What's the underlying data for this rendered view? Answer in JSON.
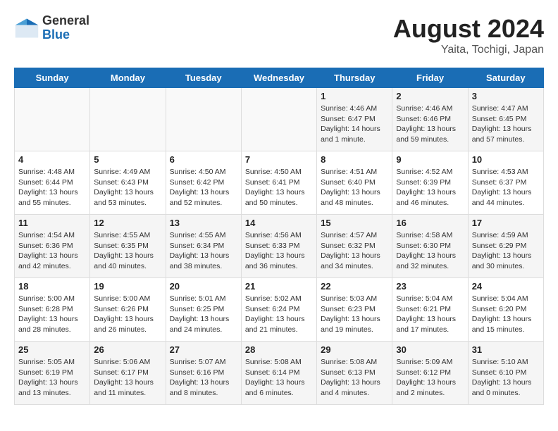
{
  "logo": {
    "general": "General",
    "blue": "Blue"
  },
  "title": "August 2024",
  "subtitle": "Yaita, Tochigi, Japan",
  "days_of_week": [
    "Sunday",
    "Monday",
    "Tuesday",
    "Wednesday",
    "Thursday",
    "Friday",
    "Saturday"
  ],
  "weeks": [
    [
      {
        "day": "",
        "info": ""
      },
      {
        "day": "",
        "info": ""
      },
      {
        "day": "",
        "info": ""
      },
      {
        "day": "",
        "info": ""
      },
      {
        "day": "1",
        "info": "Sunrise: 4:46 AM\nSunset: 6:47 PM\nDaylight: 14 hours\nand 1 minute."
      },
      {
        "day": "2",
        "info": "Sunrise: 4:46 AM\nSunset: 6:46 PM\nDaylight: 13 hours\nand 59 minutes."
      },
      {
        "day": "3",
        "info": "Sunrise: 4:47 AM\nSunset: 6:45 PM\nDaylight: 13 hours\nand 57 minutes."
      }
    ],
    [
      {
        "day": "4",
        "info": "Sunrise: 4:48 AM\nSunset: 6:44 PM\nDaylight: 13 hours\nand 55 minutes."
      },
      {
        "day": "5",
        "info": "Sunrise: 4:49 AM\nSunset: 6:43 PM\nDaylight: 13 hours\nand 53 minutes."
      },
      {
        "day": "6",
        "info": "Sunrise: 4:50 AM\nSunset: 6:42 PM\nDaylight: 13 hours\nand 52 minutes."
      },
      {
        "day": "7",
        "info": "Sunrise: 4:50 AM\nSunset: 6:41 PM\nDaylight: 13 hours\nand 50 minutes."
      },
      {
        "day": "8",
        "info": "Sunrise: 4:51 AM\nSunset: 6:40 PM\nDaylight: 13 hours\nand 48 minutes."
      },
      {
        "day": "9",
        "info": "Sunrise: 4:52 AM\nSunset: 6:39 PM\nDaylight: 13 hours\nand 46 minutes."
      },
      {
        "day": "10",
        "info": "Sunrise: 4:53 AM\nSunset: 6:37 PM\nDaylight: 13 hours\nand 44 minutes."
      }
    ],
    [
      {
        "day": "11",
        "info": "Sunrise: 4:54 AM\nSunset: 6:36 PM\nDaylight: 13 hours\nand 42 minutes."
      },
      {
        "day": "12",
        "info": "Sunrise: 4:55 AM\nSunset: 6:35 PM\nDaylight: 13 hours\nand 40 minutes."
      },
      {
        "day": "13",
        "info": "Sunrise: 4:55 AM\nSunset: 6:34 PM\nDaylight: 13 hours\nand 38 minutes."
      },
      {
        "day": "14",
        "info": "Sunrise: 4:56 AM\nSunset: 6:33 PM\nDaylight: 13 hours\nand 36 minutes."
      },
      {
        "day": "15",
        "info": "Sunrise: 4:57 AM\nSunset: 6:32 PM\nDaylight: 13 hours\nand 34 minutes."
      },
      {
        "day": "16",
        "info": "Sunrise: 4:58 AM\nSunset: 6:30 PM\nDaylight: 13 hours\nand 32 minutes."
      },
      {
        "day": "17",
        "info": "Sunrise: 4:59 AM\nSunset: 6:29 PM\nDaylight: 13 hours\nand 30 minutes."
      }
    ],
    [
      {
        "day": "18",
        "info": "Sunrise: 5:00 AM\nSunset: 6:28 PM\nDaylight: 13 hours\nand 28 minutes."
      },
      {
        "day": "19",
        "info": "Sunrise: 5:00 AM\nSunset: 6:26 PM\nDaylight: 13 hours\nand 26 minutes."
      },
      {
        "day": "20",
        "info": "Sunrise: 5:01 AM\nSunset: 6:25 PM\nDaylight: 13 hours\nand 24 minutes."
      },
      {
        "day": "21",
        "info": "Sunrise: 5:02 AM\nSunset: 6:24 PM\nDaylight: 13 hours\nand 21 minutes."
      },
      {
        "day": "22",
        "info": "Sunrise: 5:03 AM\nSunset: 6:23 PM\nDaylight: 13 hours\nand 19 minutes."
      },
      {
        "day": "23",
        "info": "Sunrise: 5:04 AM\nSunset: 6:21 PM\nDaylight: 13 hours\nand 17 minutes."
      },
      {
        "day": "24",
        "info": "Sunrise: 5:04 AM\nSunset: 6:20 PM\nDaylight: 13 hours\nand 15 minutes."
      }
    ],
    [
      {
        "day": "25",
        "info": "Sunrise: 5:05 AM\nSunset: 6:19 PM\nDaylight: 13 hours\nand 13 minutes."
      },
      {
        "day": "26",
        "info": "Sunrise: 5:06 AM\nSunset: 6:17 PM\nDaylight: 13 hours\nand 11 minutes."
      },
      {
        "day": "27",
        "info": "Sunrise: 5:07 AM\nSunset: 6:16 PM\nDaylight: 13 hours\nand 8 minutes."
      },
      {
        "day": "28",
        "info": "Sunrise: 5:08 AM\nSunset: 6:14 PM\nDaylight: 13 hours\nand 6 minutes."
      },
      {
        "day": "29",
        "info": "Sunrise: 5:08 AM\nSunset: 6:13 PM\nDaylight: 13 hours\nand 4 minutes."
      },
      {
        "day": "30",
        "info": "Sunrise: 5:09 AM\nSunset: 6:12 PM\nDaylight: 13 hours\nand 2 minutes."
      },
      {
        "day": "31",
        "info": "Sunrise: 5:10 AM\nSunset: 6:10 PM\nDaylight: 13 hours\nand 0 minutes."
      }
    ]
  ]
}
